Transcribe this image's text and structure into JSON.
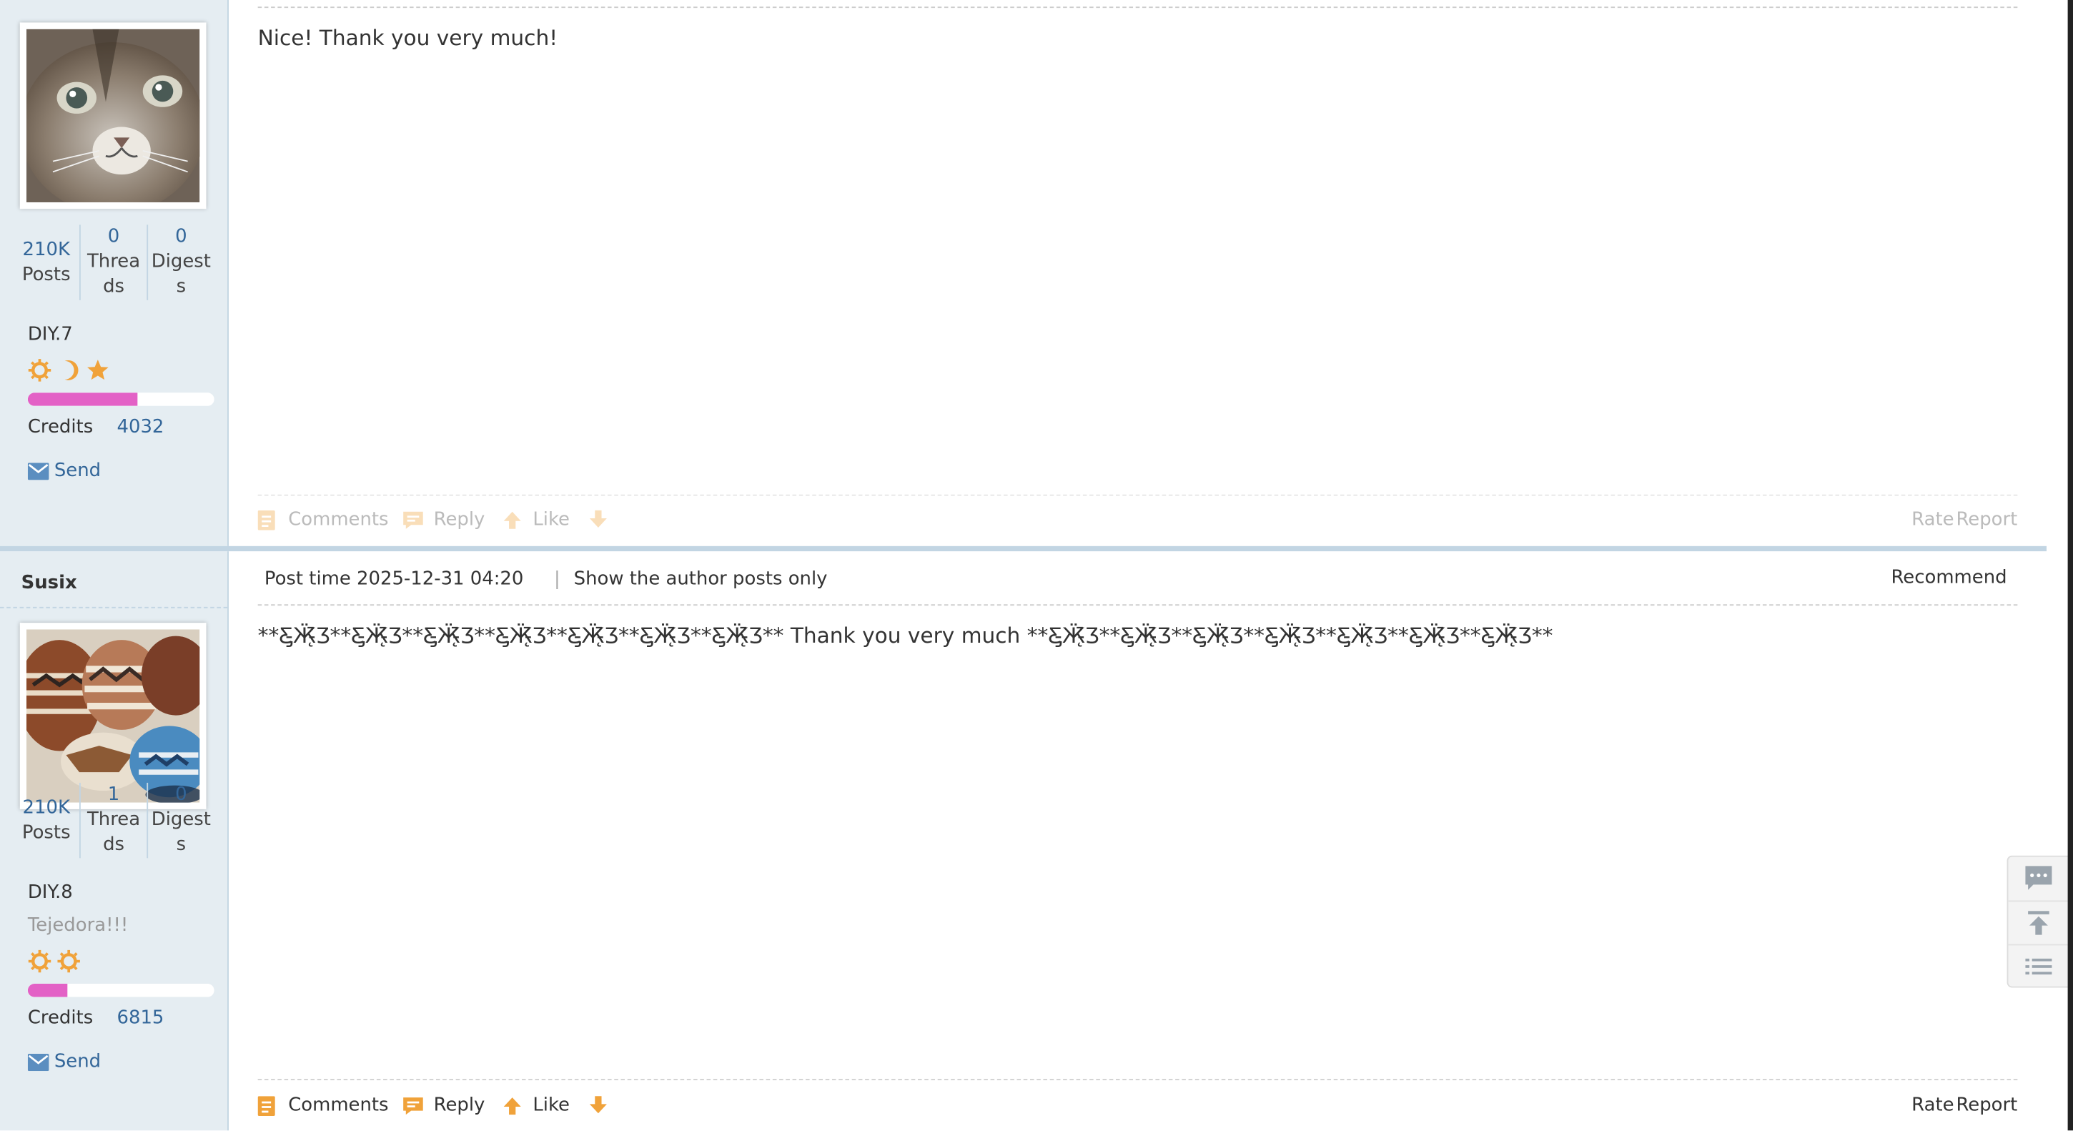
{
  "posts": [
    {
      "author": "",
      "stats": {
        "posts": "210K",
        "posts_label": "Posts",
        "threads": "0",
        "threads_label": "Threads",
        "digests": "0",
        "digests_label": "Digests"
      },
      "group": "DIY.7",
      "custom_title": "",
      "rank_icons": [
        "sun-icon",
        "moon-icon",
        "star-icon"
      ],
      "level_progress": 0.59,
      "credits_label": "Credits",
      "credits": "4032",
      "send_label": "Send",
      "message": "Nice! Thank you very much!",
      "actions": {
        "comments": "Comments",
        "reply": "Reply",
        "like": "Like",
        "rate": "Rate",
        "report": "Report"
      }
    },
    {
      "author": "Susix",
      "post_time": "Post time 2025-12-31 04:20",
      "author_only": "Show the author posts only",
      "recommend": "Recommend",
      "stats": {
        "posts": "210K",
        "posts_label": "Posts",
        "threads": "1",
        "threads_label": "Threads",
        "digests": "0",
        "digests_label": "Digests"
      },
      "group": "DIY.8",
      "custom_title": "Tejedora!!!",
      "rank_icons": [
        "sun-icon",
        "sun-icon"
      ],
      "level_progress": 0.21,
      "credits_label": "Credits",
      "credits": "6815",
      "send_label": "Send",
      "message": "**Ƹ̵̡Ӝ̵̨̄Ʒ**Ƹ̵̡Ӝ̵̨̄Ʒ**Ƹ̵̡Ӝ̵̨̄Ʒ**Ƹ̵̡Ӝ̵̨̄Ʒ**Ƹ̵̡Ӝ̵̨̄Ʒ**Ƹ̵̡Ӝ̵̨̄Ʒ**Ƹ̵̡Ӝ̵̨̄Ʒ** Thank you very much **Ƹ̵̡Ӝ̵̨̄Ʒ**Ƹ̵̡Ӝ̵̨̄Ʒ**Ƹ̵̡Ӝ̵̨̄Ʒ**Ƹ̵̡Ӝ̵̨̄Ʒ**Ƹ̵̡Ӝ̵̨̄Ʒ**Ƹ̵̡Ӝ̵̨̄Ʒ**Ƹ̵̡Ӝ̵̨̄Ʒ**",
      "actions": {
        "comments": "Comments",
        "reply": "Reply",
        "like": "Like",
        "rate": "Rate",
        "report": "Report"
      }
    }
  ],
  "side_tools": [
    "comment-icon",
    "back-to-top-icon",
    "list-icon"
  ],
  "colors": {
    "link": "#336699",
    "sidebar_bg": "#e5edf2",
    "border": "#c2d5e3",
    "progress": "#e361c6",
    "icon_orange": "#f0a23a"
  }
}
